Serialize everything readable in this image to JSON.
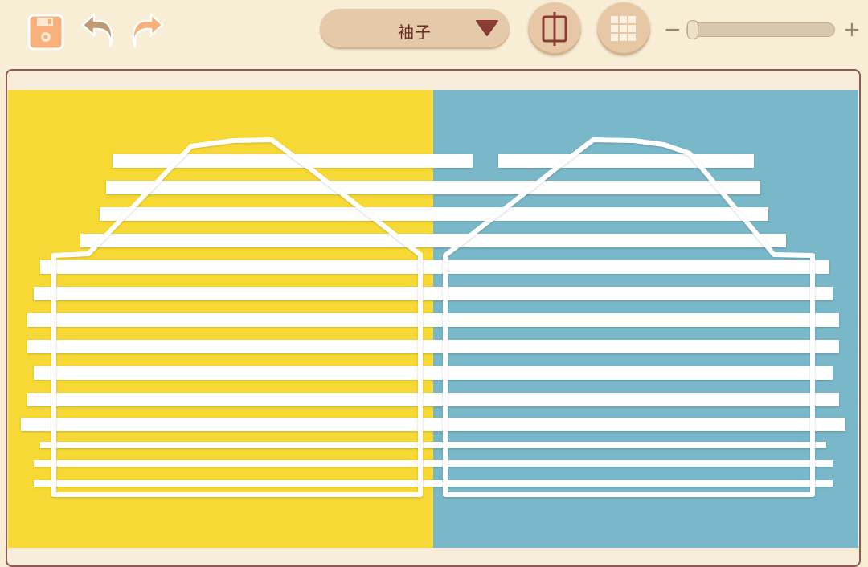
{
  "toolbar": {
    "save_icon": "save-icon",
    "undo_icon": "undo-icon",
    "redo_icon": "redo-icon",
    "part_select": {
      "selected": "袖子",
      "caret_icon": "caret-down-icon"
    },
    "symmetry_icon": "mirror-split-icon",
    "grid_icon": "grid-icon",
    "zoom": {
      "minus": "−",
      "plus": "+",
      "level": 0
    }
  },
  "canvas": {
    "left_background": "#f7d935",
    "right_background": "#79b8c8",
    "stripe_color": "#ffffff",
    "outline_color": "#ffffff"
  },
  "colors": {
    "page_background": "#f8eed6",
    "accent_brown": "#6b2f2a",
    "button_tan": "#e7c8a6",
    "save_orange": "#f7b27b"
  }
}
